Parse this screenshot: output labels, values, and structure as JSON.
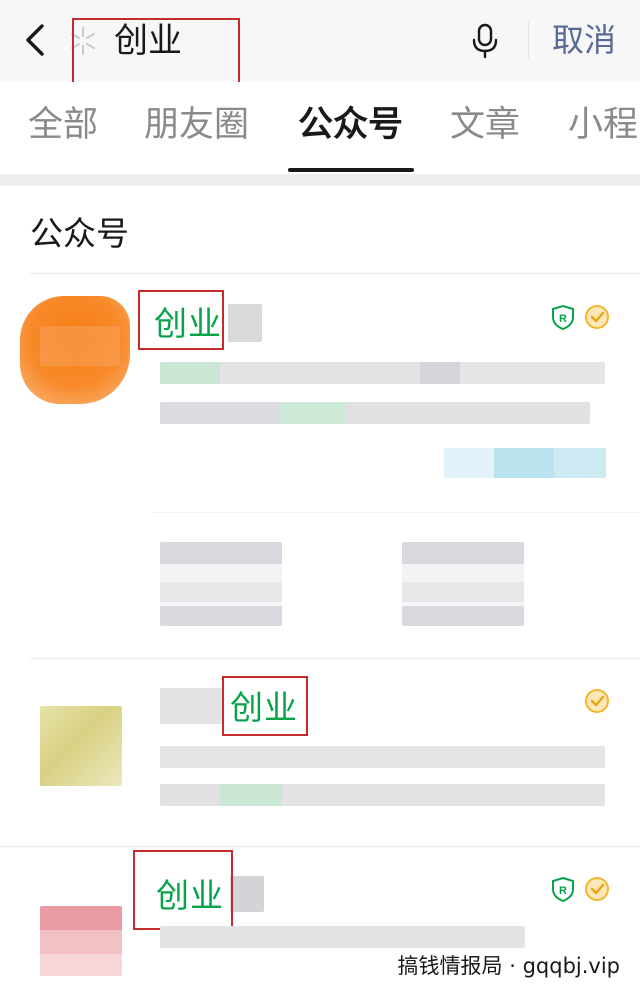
{
  "search": {
    "query": "创业",
    "cancel_label": "取消"
  },
  "tabs": [
    {
      "label": "全部"
    },
    {
      "label": "朋友圈"
    },
    {
      "label": "公众号"
    },
    {
      "label": "文章"
    },
    {
      "label": "小程"
    }
  ],
  "section": {
    "title": "公众号"
  },
  "results": [
    {
      "match_text": "创业",
      "badges": [
        "registered-icon",
        "verified-icon"
      ]
    },
    {
      "match_text": "创业",
      "badges": [
        "verified-icon"
      ]
    },
    {
      "match_text": "创业",
      "badges": [
        "registered-icon",
        "verified-icon"
      ]
    }
  ],
  "watermark": "搞钱情报局 · gqqbj.vip",
  "colors": {
    "accent_green": "#07a34a",
    "link_blue": "#576b95",
    "highlight_red": "#c62b2b",
    "verified_yellow": "#f3b52e"
  }
}
